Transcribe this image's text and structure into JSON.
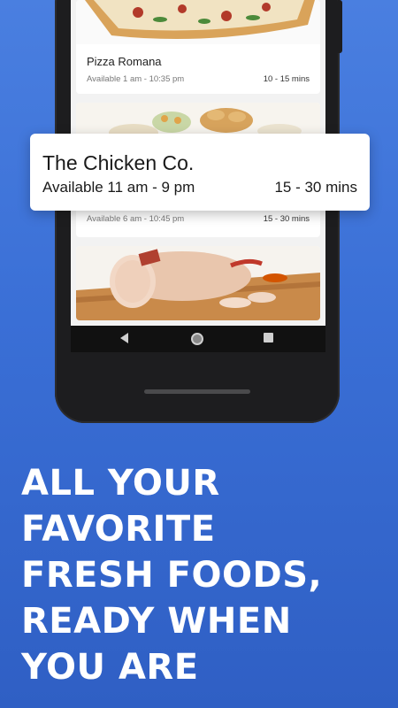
{
  "cards": [
    {
      "name": "Pizza Romana",
      "availability": "Available 1 am - 10:35 pm",
      "time": "10 - 15 mins"
    },
    {
      "name": "",
      "availability": "Available 6 am - 10:45 pm",
      "time": "15 - 30 mins"
    }
  ],
  "popup": {
    "name": "The Chicken Co.",
    "availability": "Available 11 am - 9 pm",
    "time": "15 - 30 mins"
  },
  "headline": [
    "ALL YOUR",
    "FAVORITE",
    "FRESH FOODS,",
    "READY WHEN",
    "YOU ARE"
  ],
  "colors": {
    "background": "#3a6fd6",
    "card": "#ffffff",
    "headline": "#ffffff"
  }
}
